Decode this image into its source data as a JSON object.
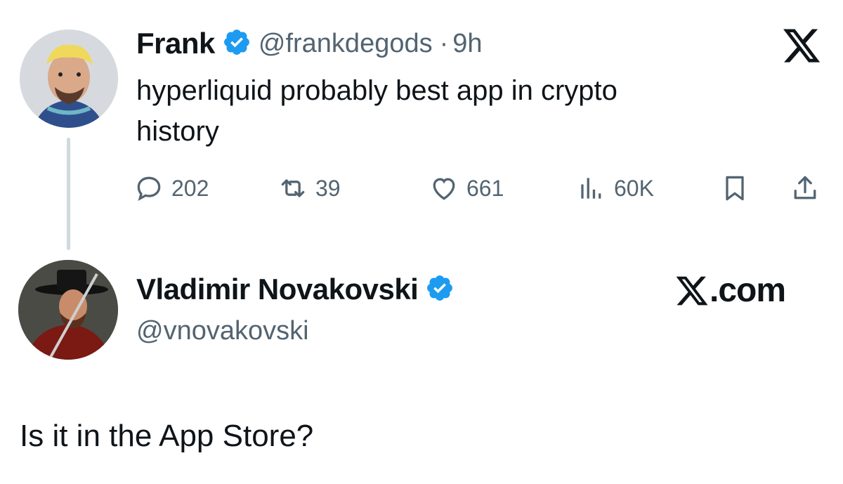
{
  "original": {
    "author_name": "Frank",
    "handle": "@frankdegods",
    "separator": "·",
    "time": "9h",
    "text_line1": "hyperliquid probably best app in crypto",
    "text_line2": "history",
    "stats": {
      "replies": "202",
      "reposts": "39",
      "likes": "661",
      "views": "60K"
    }
  },
  "reply": {
    "author_name": "Vladimir Novakovski",
    "handle": "@vnovakovski",
    "text": "Is it in the App Store?"
  },
  "brand": {
    "logo": "𝕏",
    "domain": ".com"
  },
  "colors": {
    "verified": "#1d9bf0",
    "secondary_text": "#536471",
    "thread_line": "#cfd9de"
  }
}
